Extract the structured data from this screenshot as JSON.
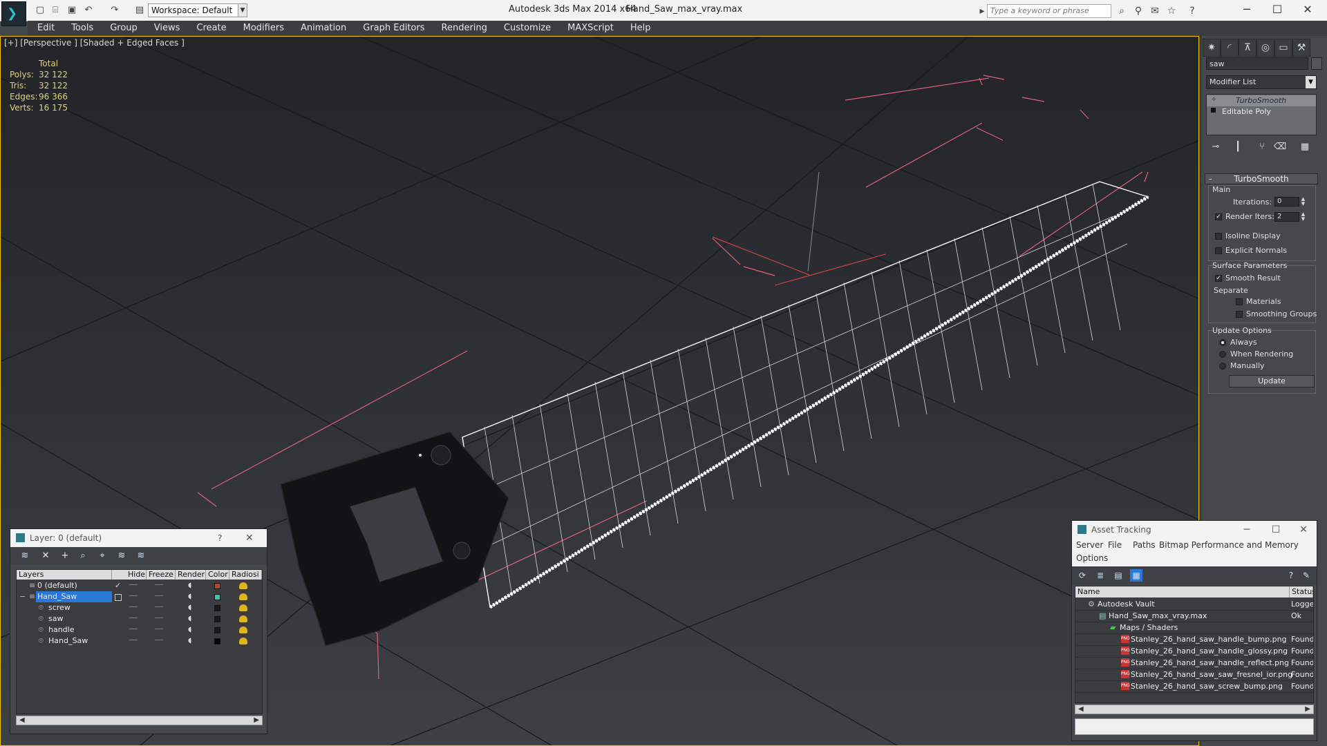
{
  "titlebar": {
    "app_title": "Autodesk 3ds Max  2014 x64",
    "file_title": "Hand_Saw_max_vray.max",
    "workspace": "Workspace: Default",
    "search_placeholder": "Type a keyword or phrase"
  },
  "menus": [
    "Edit",
    "Tools",
    "Group",
    "Views",
    "Create",
    "Modifiers",
    "Animation",
    "Graph Editors",
    "Rendering",
    "Customize",
    "MAXScript",
    "Help"
  ],
  "viewport": {
    "label": "[+] [Perspective ] [Shaded + Edged Faces ]",
    "stats": {
      "header": "Total",
      "rows": [
        {
          "k": "Polys:",
          "v": "32 122"
        },
        {
          "k": "Tris:",
          "v": "32 122"
        },
        {
          "k": "Edges:",
          "v": "96 366"
        },
        {
          "k": "Verts:",
          "v": "16 175"
        }
      ]
    }
  },
  "command_panel": {
    "object_name": "saw",
    "modifier_list": "Modifier List",
    "stack": [
      "TurboSmooth",
      "Editable Poly"
    ],
    "rollout_title": "TurboSmooth",
    "main_label": "Main",
    "iterations_label": "Iterations:",
    "iterations_value": "0",
    "render_iters_label": "Render Iters:",
    "render_iters_value": "2",
    "isoline_label": "Isoline Display",
    "explicit_label": "Explicit Normals",
    "surface_label": "Surface Parameters",
    "smooth_label": "Smooth Result",
    "separate_label": "Separate",
    "materials_label": "Materials",
    "smoothing_groups_label": "Smoothing Groups",
    "update_options_label": "Update Options",
    "always_label": "Always",
    "when_rendering_label": "When Rendering",
    "manually_label": "Manually",
    "update_button": "Update"
  },
  "layer_window": {
    "title": "Layer: 0 (default)",
    "help": "?",
    "columns": [
      "Layers",
      "Hide",
      "Freeze",
      "Render",
      "Color",
      "Radiosi"
    ],
    "rows": [
      {
        "name": "0 (default)",
        "color": "#c1411a",
        "indent": 0
      },
      {
        "name": "Hand_Saw",
        "color": "#2ec8b4",
        "indent": 0
      },
      {
        "name": "screw",
        "color": "#1a1a1a",
        "indent": 1
      },
      {
        "name": "saw",
        "color": "#1a1a1a",
        "indent": 1
      },
      {
        "name": "handle",
        "color": "#1a1a1a",
        "indent": 1
      },
      {
        "name": "Hand_Saw",
        "color": "#050505",
        "indent": 1
      }
    ]
  },
  "asset_window": {
    "title": "Asset Tracking",
    "menu": [
      "Server",
      "File",
      "Paths",
      "Bitmap Performance and Memory",
      "Options"
    ],
    "columns": [
      "Name",
      "Status"
    ],
    "rows": [
      {
        "name": "Autodesk Vault",
        "status": "Logge",
        "indent": 1
      },
      {
        "name": "Hand_Saw_max_vray.max",
        "status": "Ok",
        "indent": 2
      },
      {
        "name": "Maps / Shaders",
        "status": "",
        "indent": 3
      },
      {
        "name": "Stanley_26_hand_saw_handle_bump.png",
        "status": "Found",
        "indent": 4
      },
      {
        "name": "Stanley_26_hand_saw_handle_glossy.png",
        "status": "Found",
        "indent": 4
      },
      {
        "name": "Stanley_26_hand_saw_handle_reflect.png",
        "status": "Found",
        "indent": 4
      },
      {
        "name": "Stanley_26_hand_saw_saw_fresnel_ior.png",
        "status": "Found",
        "indent": 4
      },
      {
        "name": "Stanley_26_hand_saw_screw_bump.png",
        "status": "Found",
        "indent": 4
      }
    ]
  }
}
